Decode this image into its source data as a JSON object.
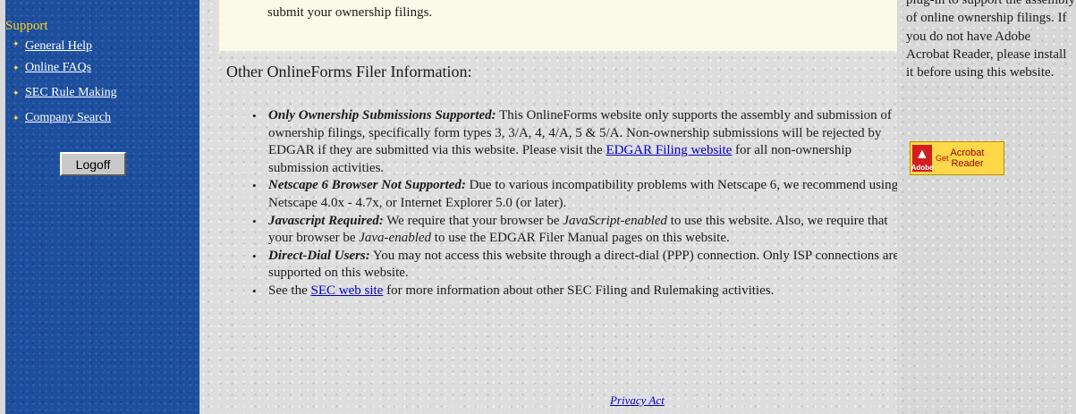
{
  "sidebar": {
    "section_title": "Support",
    "items": [
      {
        "label": "General Help"
      },
      {
        "label": "Online FAQs"
      },
      {
        "label": "SEC Rule Making"
      },
      {
        "label": "Company Search"
      }
    ],
    "logoff_label": "Logoff"
  },
  "main": {
    "notice_text": "submit your ownership filings.",
    "section_heading": "Other OnlineForms Filer Information:",
    "items": [
      {
        "title": "Only Ownership Submissions Supported:",
        "text_a": " This OnlineForms website only supports the assembly and submission of ownership filings, specifically form types 3, 3/A, 4, 4/A, 5 & 5/A. Non-ownership submissions will be rejected by EDGAR if they are submitted via this website. Please visit the ",
        "link": "EDGAR Filing website",
        "text_b": " for all non-ownership submission activities."
      },
      {
        "title": "Netscape 6 Browser Not Supported:",
        "text_a": " Due to various incompatibility problems with Netscape 6, we recommend using Netscape 4.0x - 4.7x, or Internet Explorer 5.0 (or later)."
      },
      {
        "title": "Javascript Required:",
        "text_a": " We require that your browser be ",
        "em_1": "JavaScript-enabled",
        "text_b": " to use this website. Also, we require that your browser be ",
        "em_2": "Java-enabled",
        "text_c": " to use the EDGAR Filer Manual pages on this website."
      },
      {
        "title": "Direct-Dial Users:",
        "text_a": " You may not access this website through a direct-dial (PPP) connection. Only ISP connections are supported on this website."
      },
      {
        "text_a": "See the ",
        "link": "SEC web site",
        "text_b": " for more information about other SEC Filing and Rulemaking activities."
      }
    ],
    "privacy_link": "Privacy Act"
  },
  "right": {
    "text": "plug-in to support the assembly of online ownership filings. If you do not have Adobe Acrobat Reader, please install it before using this website.",
    "badge": {
      "brand": "Adobe",
      "get": "Get",
      "product_line1": "Acrobat",
      "product_line2": "Reader"
    }
  }
}
